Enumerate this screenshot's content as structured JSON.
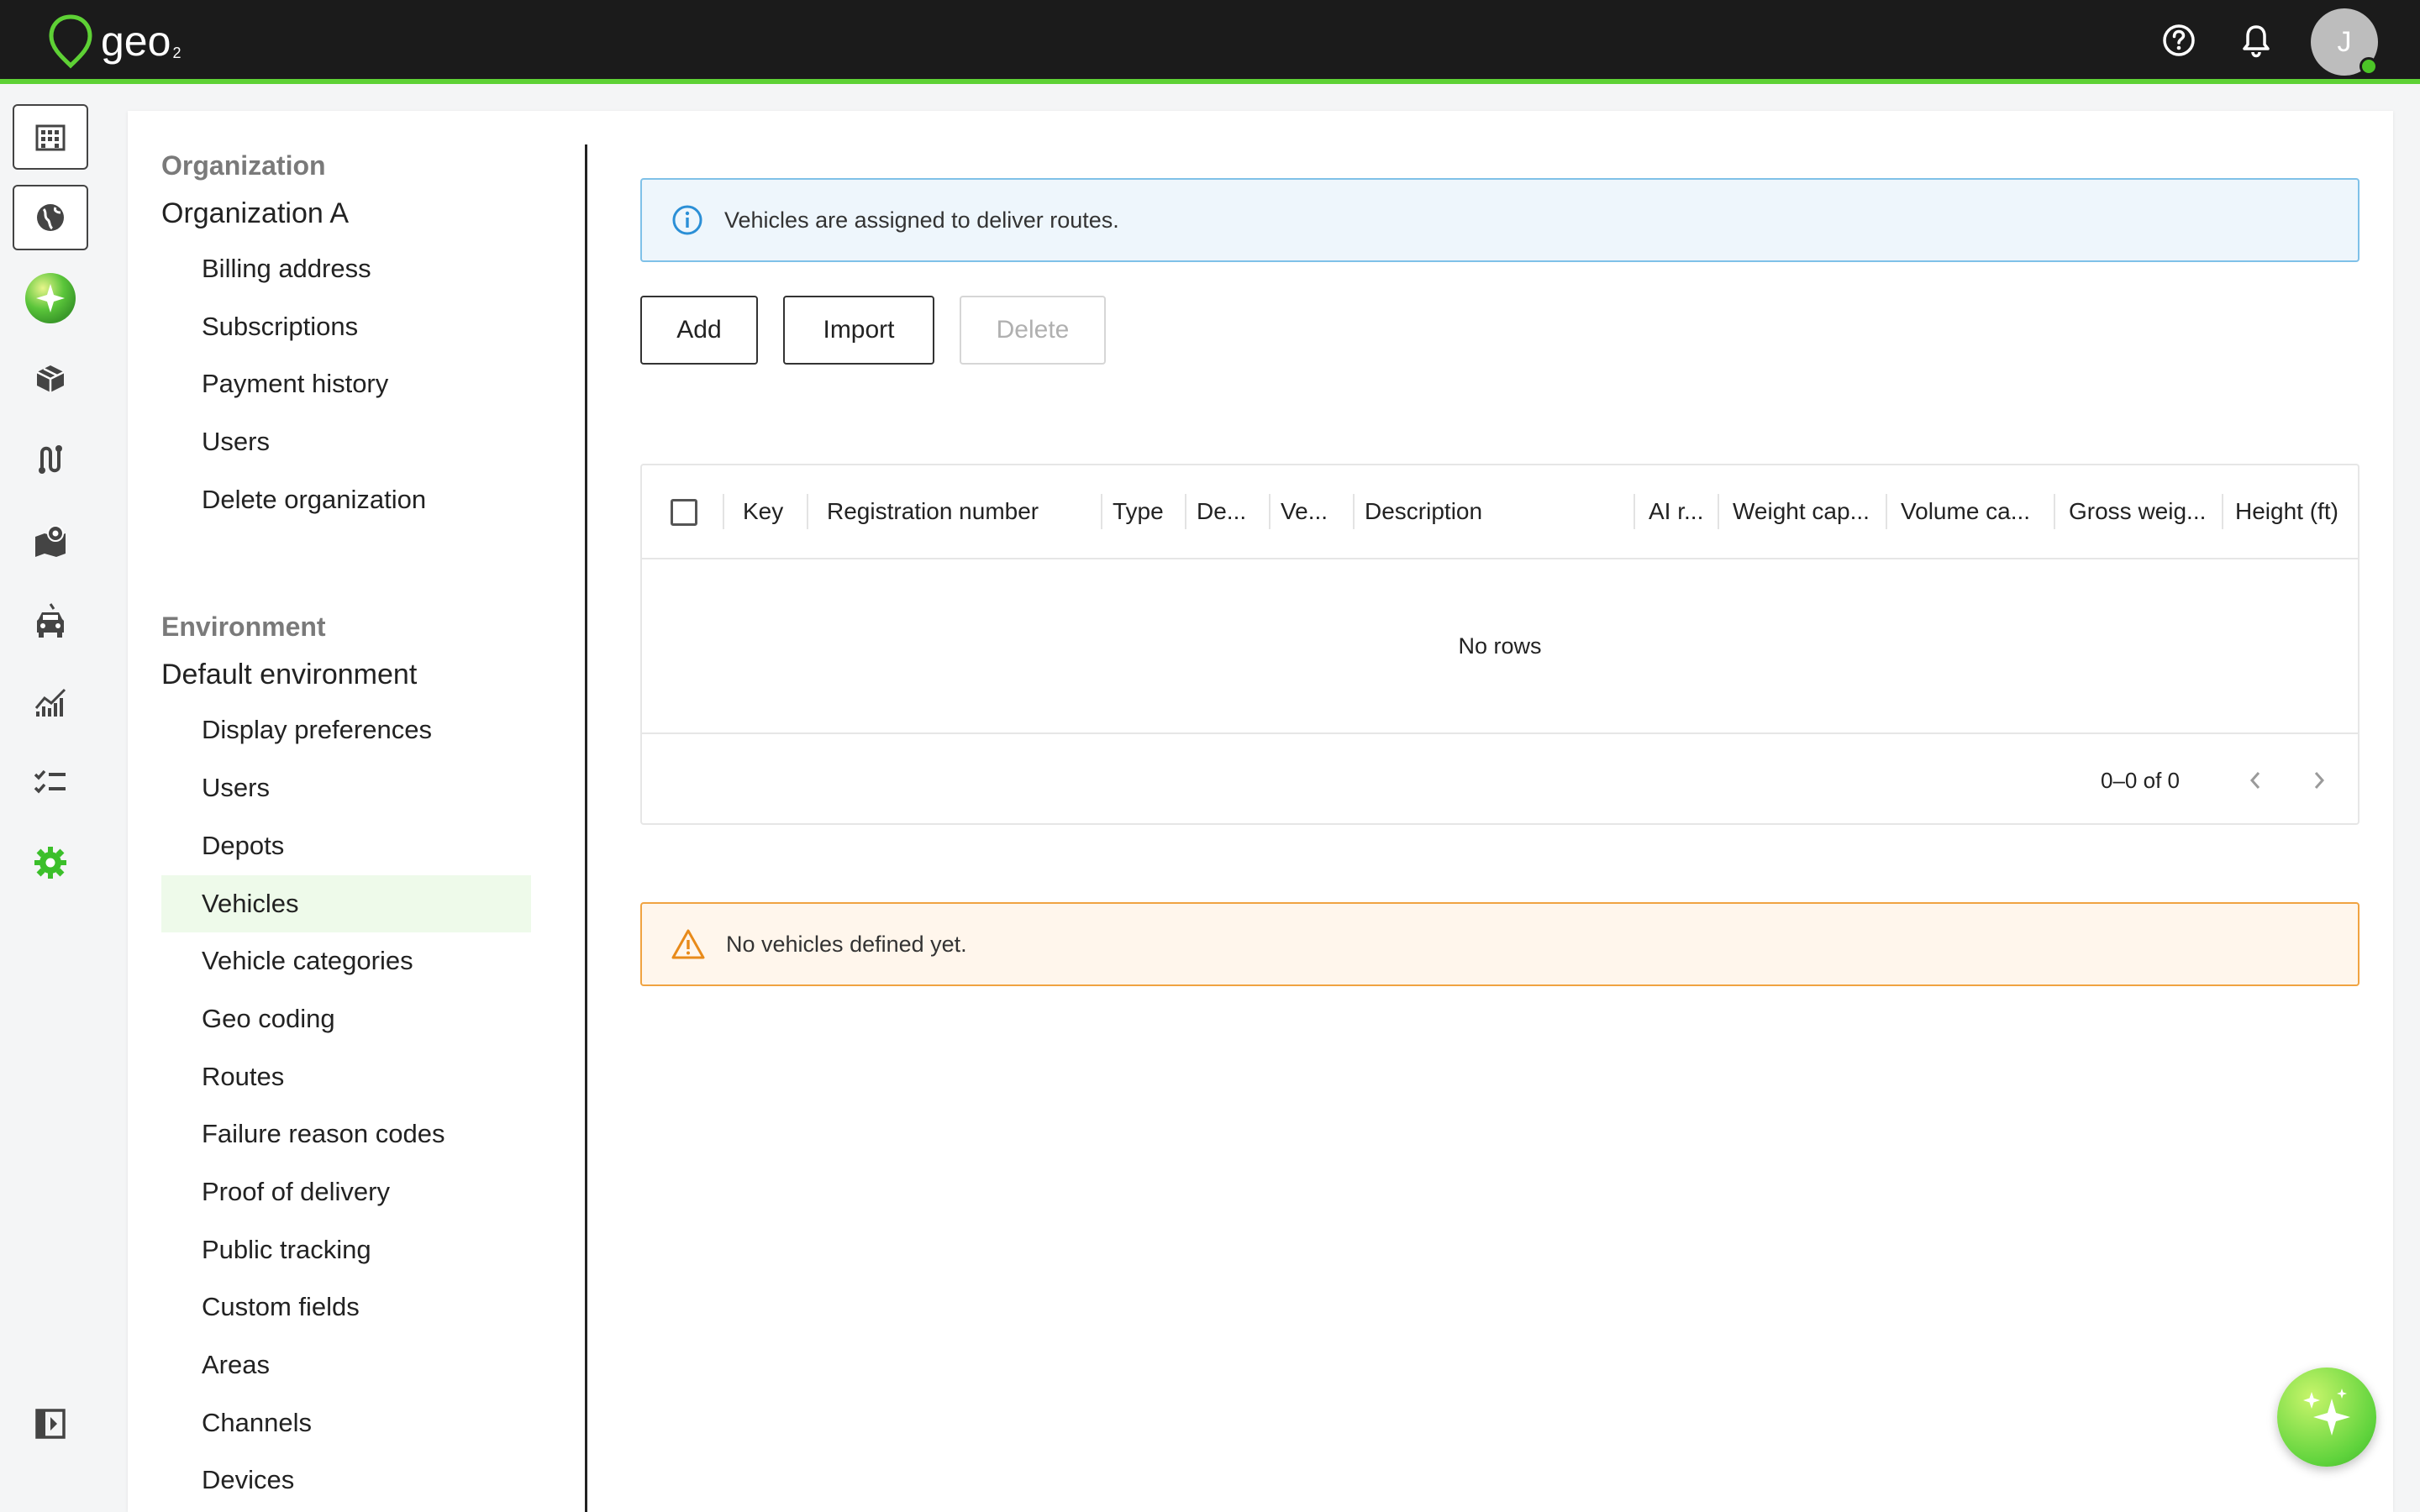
{
  "app": {
    "logo_text": "geo",
    "logo_sub": "2",
    "avatar_initial": "J"
  },
  "icons": {
    "help": "help-circle-icon",
    "notifications": "bell-icon",
    "rail": [
      "building-icon",
      "globe-icon",
      "ai-sparkle-icon",
      "package-icon",
      "route-icon",
      "map-pin-icon",
      "vehicle-icon",
      "analytics-icon",
      "checklist-icon",
      "settings-icon",
      "collapse-sidebar-icon"
    ]
  },
  "colors": {
    "accent_green": "#5ed135",
    "info_border": "#7fc1e8",
    "warning_border": "#f0a341",
    "active_nav_bg": "#eefaea"
  },
  "organization": {
    "heading": "Organization",
    "name": "Organization A",
    "items": [
      "Billing address",
      "Subscriptions",
      "Payment history",
      "Users",
      "Delete organization"
    ]
  },
  "environment": {
    "heading": "Environment",
    "name": "Default environment",
    "items": [
      "Display preferences",
      "Users",
      "Depots",
      "Vehicles",
      "Vehicle categories",
      "Geo coding",
      "Routes",
      "Failure reason codes",
      "Proof of delivery",
      "Public tracking",
      "Custom fields",
      "Areas",
      "Channels",
      "Devices"
    ],
    "active": "Vehicles"
  },
  "info_banner": "Vehicles are assigned to deliver routes.",
  "actions": {
    "add": "Add",
    "import": "Import",
    "delete": "Delete"
  },
  "table": {
    "columns": [
      "Key",
      "Registration number",
      "Type",
      "De...",
      "Ve...",
      "Description",
      "AI r...",
      "Weight cap...",
      "Volume ca...",
      "Gross weig...",
      "Height (ft)"
    ],
    "empty_text": "No rows",
    "pagination": "0–0 of 0"
  },
  "warning_banner": "No vehicles defined yet."
}
